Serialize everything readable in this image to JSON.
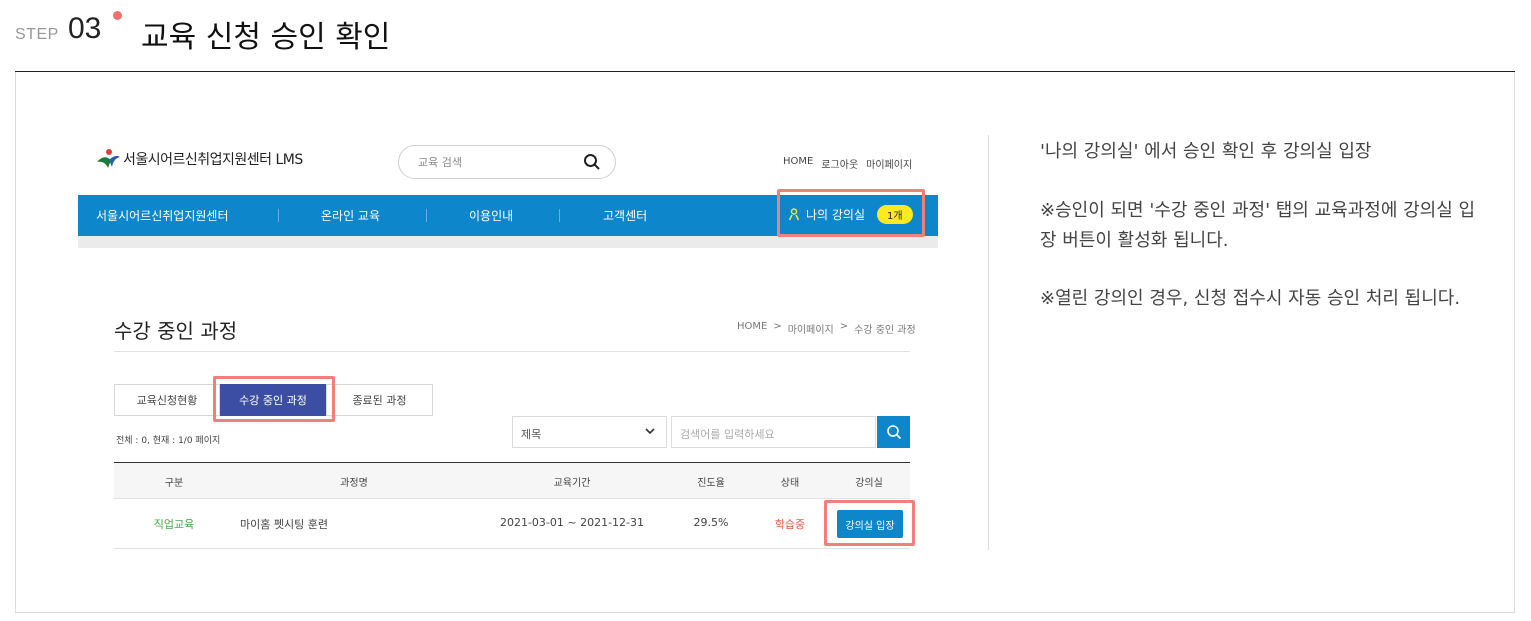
{
  "step": {
    "label": "STEP",
    "number": "03",
    "title": "교육 신청 승인 확인"
  },
  "site": {
    "logo_text": "서울시어르신취업지원센터 LMS",
    "search_placeholder": "교육 검색",
    "top_links": [
      "HOME",
      "로그아웃",
      "마이페이지"
    ]
  },
  "nav": {
    "items": [
      "서울시어르신취업지원센터",
      "온라인 교육",
      "이용인내",
      "고객센터"
    ],
    "my_class_label": "나의 강의실",
    "my_class_badge": "1개"
  },
  "page": {
    "title": "수강 중인 과정",
    "breadcrumb": [
      "HOME",
      ">",
      "마이페이지",
      ">",
      "수강 중인 과정"
    ],
    "tabs": [
      "교육신청현황",
      "수강 중인 과정",
      "종료된 과정"
    ],
    "active_tab": "수강 중인 과정",
    "count_text": "전체 : 0, 현재 : 1/0 페이지",
    "select_value": "제목",
    "keyword_placeholder": "검색어를 입력하세요"
  },
  "table": {
    "headers": [
      "구분",
      "과정명",
      "교육기간",
      "진도율",
      "상태",
      "강의실"
    ],
    "rows": [
      {
        "category": "직업교육",
        "course": "마이홈 펫시팅 훈련",
        "period": "2021-03-01 ~ 2021-12-31",
        "progress": "29.5%",
        "status": "학습중",
        "action": "강의실 입장"
      }
    ]
  },
  "instructions": {
    "line1": "'나의 강의실' 에서 승인 확인 후 강의실 입장",
    "note1": "※승인이 되면 '수강 중인 과정' 탭의 교육과정에 강의실 입장 버튼이 활성화 됩니다.",
    "note2": "※열린 강의인 경우, 신청 접수시 자동 승인 처리 됩니다."
  },
  "colors": {
    "brand_blue": "#0e86cb",
    "tab_active": "#3b4ea3",
    "highlight": "#f08079",
    "badge": "#ffe923",
    "category_green": "#4aa84a",
    "status_red": "#e05a4a"
  }
}
